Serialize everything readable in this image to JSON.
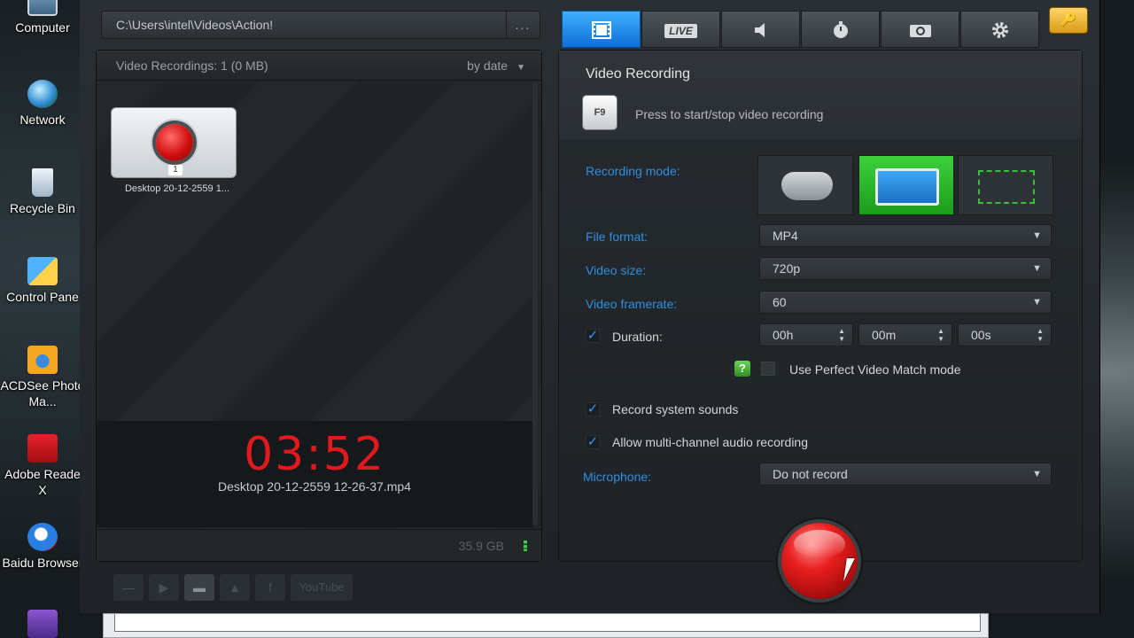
{
  "desktop": {
    "icons": [
      {
        "label": "Computer",
        "icon": "computer-icon"
      },
      {
        "label": "Network",
        "icon": "network-icon"
      },
      {
        "label": "Recycle Bin",
        "icon": "recycle-bin-icon"
      },
      {
        "label": "Control Pane",
        "icon": "control-panel-icon"
      },
      {
        "label": "ACDSee Photo Ma...",
        "icon": "acdsee-icon"
      },
      {
        "label": "Adobe Reade X",
        "icon": "adobe-reader-icon"
      },
      {
        "label": "Baidu Browser",
        "icon": "baidu-browser-icon"
      },
      {
        "label": "",
        "icon": "app-icon"
      }
    ]
  },
  "path_bar": {
    "path": "C:\\Users\\intel\\Videos\\Action!",
    "more": "..."
  },
  "recordings": {
    "header": "Video Recordings: 1 (0 MB)",
    "sort_label": "by date",
    "items": [
      {
        "caption": "Desktop 20-12-2559 1...",
        "index": "1"
      }
    ],
    "timer": "03:52",
    "filename": "Desktop 20-12-2559 12-26-37.mp4",
    "disk_free": "35.9 GB"
  },
  "toolbar": {
    "youtube": "YouTube"
  },
  "tabs": [
    {
      "name": "video-recording",
      "icon": "film-icon",
      "active": true
    },
    {
      "name": "live",
      "label": "LIVE",
      "icon": "live-icon"
    },
    {
      "name": "audio",
      "icon": "speaker-icon"
    },
    {
      "name": "benchmark",
      "icon": "stopwatch-icon"
    },
    {
      "name": "screenshot",
      "icon": "camera-icon"
    },
    {
      "name": "settings",
      "icon": "gear-icon"
    }
  ],
  "video_recording": {
    "title": "Video Recording",
    "hotkey": "F9",
    "hotkey_desc": "Press to start/stop video recording",
    "recording_mode_label": "Recording mode:",
    "recording_mode_selected": "screen",
    "file_format_label": "File format:",
    "file_format": "MP4",
    "video_size_label": "Video size:",
    "video_size": "720p",
    "video_framerate_label": "Video framerate:",
    "video_framerate": "60",
    "duration_label": "Duration:",
    "duration_checked": true,
    "duration_h": "00h",
    "duration_m": "00m",
    "duration_s": "00s",
    "help": "?",
    "perfect_match_label": "Use Perfect Video Match mode",
    "perfect_match_checked": false,
    "system_sounds_label": "Record system sounds",
    "system_sounds_checked": true,
    "multichannel_label": "Allow multi-channel audio recording",
    "multichannel_checked": true,
    "microphone_label": "Microphone:",
    "microphone": "Do not record"
  },
  "colors": {
    "accent_blue": "#1a8ae8",
    "label_blue": "#2f8fe0",
    "timer_red": "#e0191d",
    "mode_active_green": "#2fb52e",
    "record_red": "#e81e1e"
  }
}
